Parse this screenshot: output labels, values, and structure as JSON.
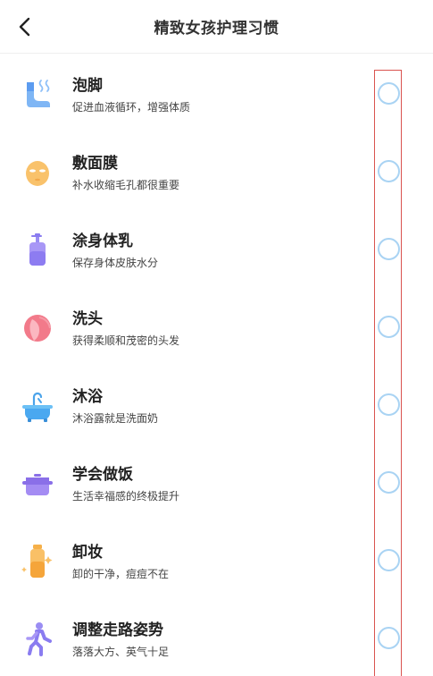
{
  "header": {
    "title": "精致女孩护理习惯"
  },
  "items": [
    {
      "name": "泡脚",
      "desc": "促进血液循环，增强体质",
      "icon": "foot-soak-icon"
    },
    {
      "name": "敷面膜",
      "desc": "补水收缩毛孔都很重要",
      "icon": "face-mask-icon"
    },
    {
      "name": "涂身体乳",
      "desc": "保存身体皮肤水分",
      "icon": "lotion-bottle-icon"
    },
    {
      "name": "洗头",
      "desc": "获得柔顺和茂密的头发",
      "icon": "hair-icon"
    },
    {
      "name": "沐浴",
      "desc": "沐浴露就是洗面奶",
      "icon": "bathtub-icon"
    },
    {
      "name": "学会做饭",
      "desc": "生活幸福感的终极提升",
      "icon": "cooking-pot-icon"
    },
    {
      "name": "卸妆",
      "desc": "卸的干净，痘痘不在",
      "icon": "makeup-remover-icon"
    },
    {
      "name": "调整走路姿势",
      "desc": "落落大方、英气十足",
      "icon": "walking-person-icon"
    }
  ],
  "colors": {
    "checkbox_border": "#a9d3f3",
    "highlight_box": "#d9534f"
  }
}
